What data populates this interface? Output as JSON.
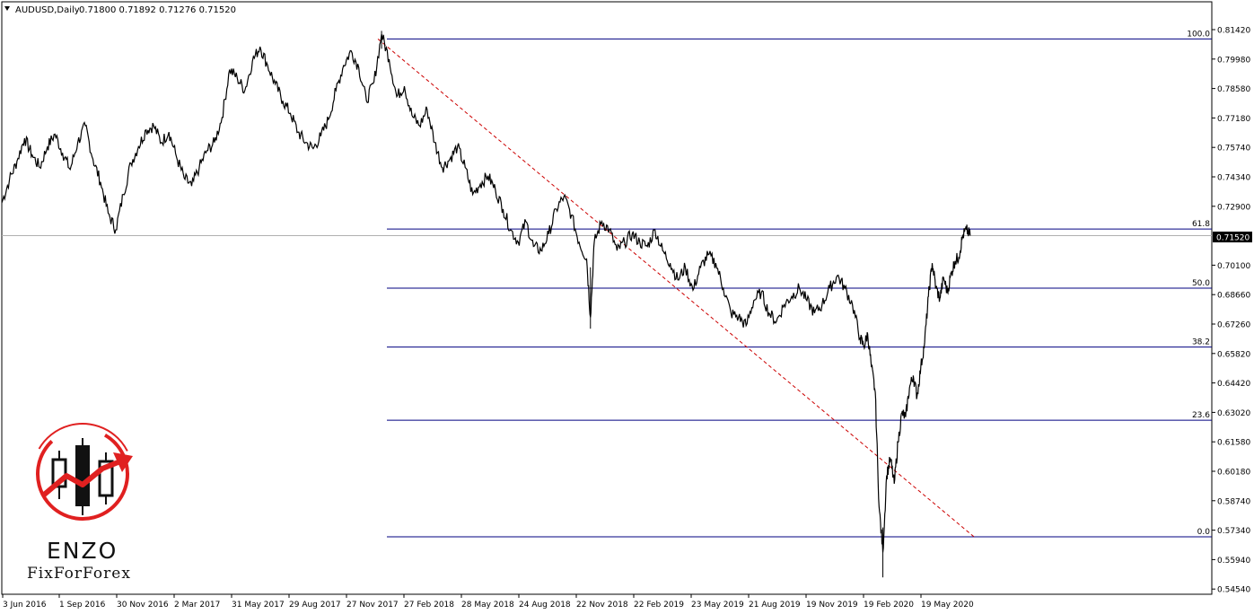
{
  "header": {
    "symbol": "AUDUSD,Daily",
    "ohlc": "0.71800 0.71892 0.71276 0.71520"
  },
  "chart_data": {
    "type": "line",
    "y_ticks": [
      "0.81420",
      "0.79980",
      "0.78580",
      "0.77180",
      "0.75740",
      "0.74340",
      "0.72900",
      "0.71520",
      "0.70100",
      "0.68660",
      "0.67260",
      "0.65820",
      "0.64420",
      "0.63020",
      "0.61580",
      "0.60180",
      "0.58740",
      "0.57340",
      "0.55940",
      "0.54540"
    ],
    "x_ticks": [
      "3 Jun 2016",
      "1 Sep 2016",
      "30 Nov 2016",
      "2 Mar 2017",
      "31 May 2017",
      "29 Aug 2017",
      "27 Nov 2017",
      "27 Feb 2018",
      "28 May 2018",
      "24 Aug 2018",
      "22 Nov 2018",
      "22 Feb 2019",
      "23 May 2019",
      "21 Aug 2019",
      "19 Nov 2019",
      "19 Feb 2020",
      "19 May 2020"
    ],
    "current_price": "0.71520",
    "ylim": [
      0.5454,
      0.8212
    ],
    "price_path": [
      [
        0,
        0.731
      ],
      [
        0.02,
        0.742
      ],
      [
        0.04,
        0.751
      ],
      [
        0.06,
        0.762
      ],
      [
        0.08,
        0.754
      ],
      [
        0.1,
        0.748
      ],
      [
        0.12,
        0.758
      ],
      [
        0.14,
        0.764
      ],
      [
        0.16,
        0.755
      ],
      [
        0.18,
        0.747
      ],
      [
        0.2,
        0.76
      ],
      [
        0.22,
        0.768
      ],
      [
        0.24,
        0.752
      ],
      [
        0.26,
        0.741
      ],
      [
        0.28,
        0.726
      ],
      [
        0.3,
        0.718
      ],
      [
        0.32,
        0.735
      ],
      [
        0.34,
        0.75
      ],
      [
        0.36,
        0.758
      ],
      [
        0.38,
        0.766
      ],
      [
        0.4,
        0.768
      ],
      [
        0.42,
        0.76
      ],
      [
        0.44,
        0.765
      ],
      [
        0.46,
        0.753
      ],
      [
        0.48,
        0.743
      ],
      [
        0.5,
        0.739
      ],
      [
        0.52,
        0.748
      ],
      [
        0.54,
        0.756
      ],
      [
        0.56,
        0.76
      ],
      [
        0.58,
        0.772
      ],
      [
        0.6,
        0.795
      ],
      [
        0.62,
        0.791
      ],
      [
        0.64,
        0.785
      ],
      [
        0.66,
        0.799
      ],
      [
        0.68,
        0.806
      ],
      [
        0.7,
        0.797
      ],
      [
        0.72,
        0.788
      ],
      [
        0.74,
        0.78
      ],
      [
        0.76,
        0.774
      ],
      [
        0.78,
        0.765
      ],
      [
        0.8,
        0.76
      ],
      [
        0.82,
        0.757
      ],
      [
        0.84,
        0.763
      ],
      [
        0.86,
        0.771
      ],
      [
        0.88,
        0.785
      ],
      [
        0.9,
        0.797
      ],
      [
        0.92,
        0.804
      ],
      [
        0.94,
        0.796
      ],
      [
        0.96,
        0.78
      ],
      [
        0.98,
        0.789
      ],
      [
        1.0,
        0.812
      ],
      [
        1.02,
        0.8
      ],
      [
        1.04,
        0.782
      ],
      [
        1.06,
        0.787
      ],
      [
        1.08,
        0.773
      ],
      [
        1.1,
        0.768
      ],
      [
        1.12,
        0.776
      ],
      [
        1.14,
        0.76
      ],
      [
        1.16,
        0.748
      ],
      [
        1.18,
        0.752
      ],
      [
        1.2,
        0.758
      ],
      [
        1.22,
        0.748
      ],
      [
        1.24,
        0.735
      ],
      [
        1.26,
        0.74
      ],
      [
        1.28,
        0.744
      ],
      [
        1.3,
        0.737
      ],
      [
        1.32,
        0.728
      ],
      [
        1.34,
        0.718
      ],
      [
        1.36,
        0.712
      ],
      [
        1.38,
        0.722
      ],
      [
        1.4,
        0.71
      ],
      [
        1.42,
        0.708
      ],
      [
        1.44,
        0.716
      ],
      [
        1.46,
        0.728
      ],
      [
        1.48,
        0.734
      ],
      [
        1.5,
        0.725
      ],
      [
        1.52,
        0.712
      ],
      [
        1.54,
        0.704
      ],
      [
        1.55,
        0.676
      ],
      [
        1.56,
        0.712
      ],
      [
        1.58,
        0.722
      ],
      [
        1.6,
        0.718
      ],
      [
        1.62,
        0.708
      ],
      [
        1.64,
        0.712
      ],
      [
        1.66,
        0.716
      ],
      [
        1.68,
        0.712
      ],
      [
        1.7,
        0.71
      ],
      [
        1.72,
        0.718
      ],
      [
        1.74,
        0.708
      ],
      [
        1.76,
        0.702
      ],
      [
        1.78,
        0.694
      ],
      [
        1.8,
        0.7
      ],
      [
        1.82,
        0.689
      ],
      [
        1.84,
        0.7
      ],
      [
        1.86,
        0.706
      ],
      [
        1.88,
        0.702
      ],
      [
        1.9,
        0.69
      ],
      [
        1.92,
        0.678
      ],
      [
        1.94,
        0.676
      ],
      [
        1.96,
        0.672
      ],
      [
        1.98,
        0.684
      ],
      [
        2.0,
        0.688
      ],
      [
        2.02,
        0.678
      ],
      [
        2.04,
        0.674
      ],
      [
        2.06,
        0.682
      ],
      [
        2.08,
        0.686
      ],
      [
        2.1,
        0.69
      ],
      [
        2.12,
        0.684
      ],
      [
        2.14,
        0.678
      ],
      [
        2.16,
        0.682
      ],
      [
        2.18,
        0.69
      ],
      [
        2.2,
        0.696
      ],
      [
        2.22,
        0.69
      ],
      [
        2.24,
        0.682
      ],
      [
        2.26,
        0.666
      ],
      [
        2.27,
        0.662
      ],
      [
        2.28,
        0.668
      ],
      [
        2.29,
        0.652
      ],
      [
        2.3,
        0.64
      ],
      [
        2.31,
        0.585
      ],
      [
        2.32,
        0.563
      ],
      [
        2.33,
        0.6
      ],
      [
        2.34,
        0.608
      ],
      [
        2.35,
        0.596
      ],
      [
        2.36,
        0.616
      ],
      [
        2.37,
        0.63
      ],
      [
        2.38,
        0.628
      ],
      [
        2.39,
        0.642
      ],
      [
        2.4,
        0.648
      ],
      [
        2.41,
        0.638
      ],
      [
        2.42,
        0.652
      ],
      [
        2.43,
        0.664
      ],
      [
        2.44,
        0.686
      ],
      [
        2.45,
        0.702
      ],
      [
        2.46,
        0.69
      ],
      [
        2.47,
        0.685
      ],
      [
        2.48,
        0.695
      ],
      [
        2.49,
        0.688
      ],
      [
        2.5,
        0.697
      ],
      [
        2.51,
        0.703
      ],
      [
        2.52,
        0.705
      ],
      [
        2.53,
        0.715
      ],
      [
        2.54,
        0.718
      ],
      [
        2.55,
        0.7152
      ]
    ],
    "fib_levels": [
      {
        "label": "100.0",
        "value": 0.8097
      },
      {
        "label": "61.8",
        "value": 0.7184
      },
      {
        "label": "50.0",
        "value": 0.69
      },
      {
        "label": "38.2",
        "value": 0.6617
      },
      {
        "label": "23.6",
        "value": 0.6265
      },
      {
        "label": "0.0",
        "value": 0.5705
      }
    ],
    "trendline": {
      "from": [
        1.0,
        0.8097
      ],
      "to": [
        2.56,
        0.5705
      ]
    }
  },
  "logo": {
    "name": "ENZO",
    "subtitle": "FixForForex"
  },
  "colors": {
    "fib_line": "#000080",
    "trendline": "#cc0000",
    "price": "#000000",
    "current_price_label_bg": "#000000",
    "logo_red": "#e02020"
  }
}
